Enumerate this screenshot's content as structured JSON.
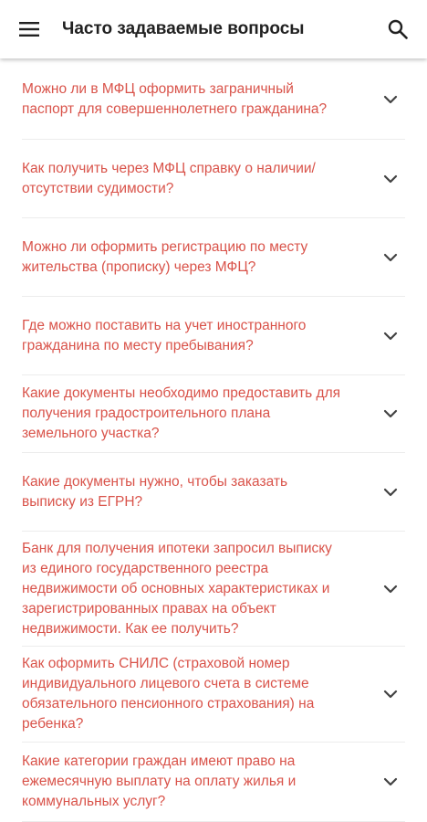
{
  "header": {
    "title": "Часто задаваемые вопросы",
    "menu_icon": "hamburger-menu-icon",
    "search_icon": "search-icon"
  },
  "faq": [
    {
      "question": "Можно ли в МФЦ оформить заграничный паспорт для совершеннолетнего гражданина?"
    },
    {
      "question": "Как получить через МФЦ справку о наличии/отсутствии судимости?"
    },
    {
      "question": "Можно ли оформить регистрацию по месту жительства (прописку) через МФЦ?"
    },
    {
      "question": "Где можно поставить на учет иностранного гражданина по месту пребывания?"
    },
    {
      "question": "Какие документы необходимо предоставить для получения градостроительного плана земельного участка?"
    },
    {
      "question": "Какие документы нужно, чтобы заказать выписку из ЕГРН?"
    },
    {
      "question": "Банк для получения ипотеки запросил выписку из единого государственного реестра недвижимости об основных характеристиках и зарегистрированных правах на объект недвижимости. Как ее получить?"
    },
    {
      "question": "Как оформить СНИЛС (страховой номер индивидуального лицевого счета в системе обязательного пенсионного страхования) на ребенка?"
    },
    {
      "question": "Какие категории граждан имеют право на ежемесячную выплату на оплату жилья и коммунальных услуг?"
    }
  ],
  "colors": {
    "question_text": "#d9534a",
    "title_text": "#212121",
    "divider": "#ececec",
    "chevron": "#424242"
  }
}
